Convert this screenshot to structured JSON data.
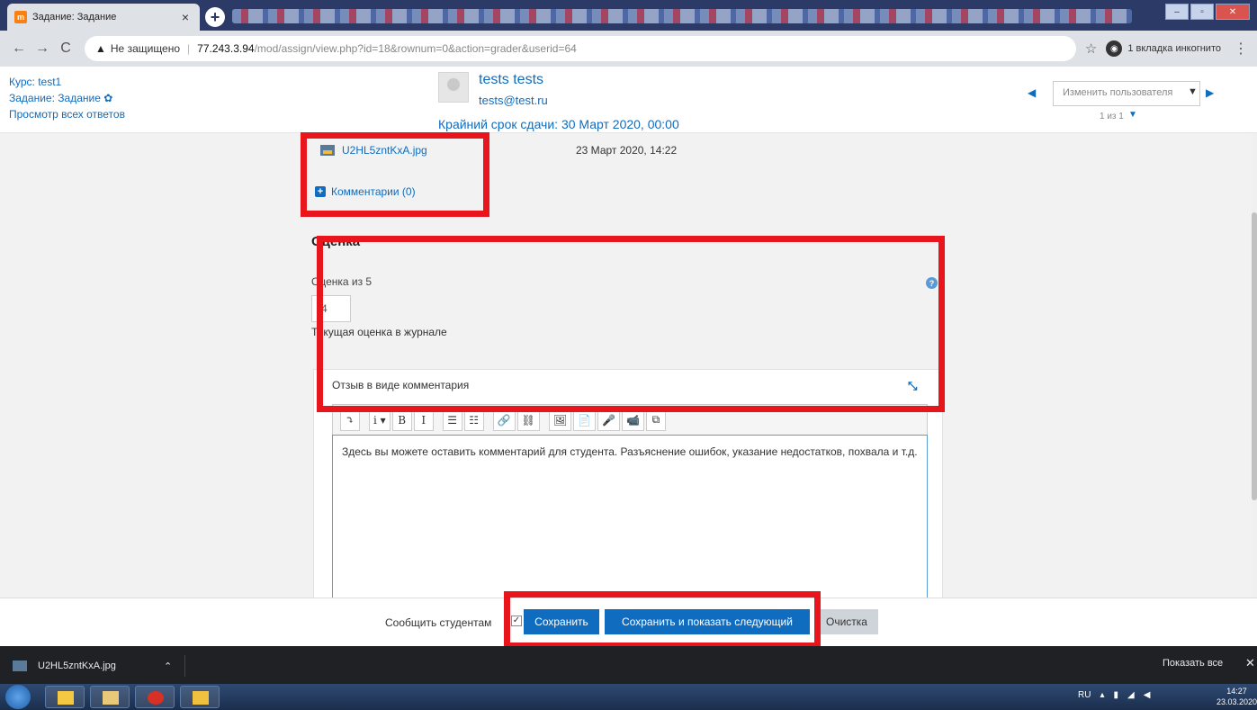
{
  "browser": {
    "tab_title": "Задание: Задание",
    "insecure_label": "Не защищено",
    "url_host": "77.243.3.94",
    "url_path": "/mod/assign/view.php?id=18&rownum=0&action=grader&userid=64",
    "incognito_label": "1 вкладка инкогнито"
  },
  "header": {
    "course_link": "Курс: test1",
    "assignment_link": "Задание: Задание",
    "view_all_link": "Просмотр всех ответов",
    "user_name": "tests tests",
    "user_email": "tests@test.ru",
    "due_date": "Крайний срок сдачи: 30 Март 2020, 00:00",
    "change_user_placeholder": "Изменить пользователя",
    "user_count": "1 из 1"
  },
  "submission": {
    "file_name": "U2HL5zntKxA.jpg",
    "file_date": "23 Март 2020, 14:22",
    "comments_link": "Комментарии (0)"
  },
  "grade": {
    "heading": "Оценка",
    "label": "Оценка из 5",
    "value": "4",
    "gradebook_note": "Текущая оценка в журнале"
  },
  "feedback": {
    "label": "Отзыв в виде комментария",
    "text": "Здесь вы можете оставить комментарий для студента. Разъяснение ошибок, указание недостатков, похвала и т.д."
  },
  "toolbar": {
    "buttons": [
      "⤵",
      "i ▾",
      "B",
      "I",
      "☰",
      "☷",
      "🔗",
      "⛓",
      "🖼",
      "📄",
      "🎤",
      "📹",
      "⧉"
    ]
  },
  "footer": {
    "notify_label": "Сообщить студентам",
    "save_label": "Сохранить",
    "save_next_label": "Сохранить и показать следующий",
    "reset_label": "Очистка"
  },
  "downloads": {
    "file_name": "U2HL5zntKxA.jpg",
    "show_all_label": "Показать все"
  },
  "taskbar": {
    "lang": "RU",
    "time": "14:27",
    "date": "23.03.2020"
  }
}
